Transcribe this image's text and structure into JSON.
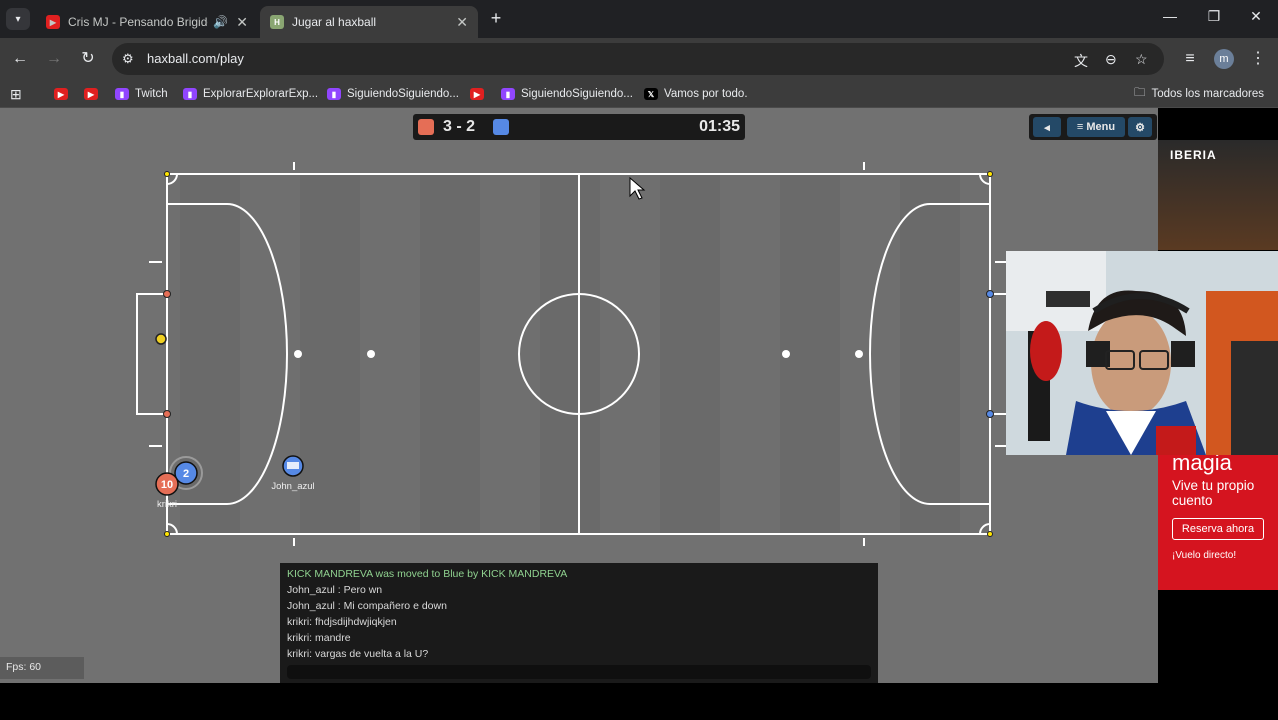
{
  "browser": {
    "tabs": [
      {
        "title": "Cris MJ - Pensando Brigido",
        "active": false,
        "audio": true
      },
      {
        "title": "Jugar al haxball",
        "active": true,
        "audio": false
      }
    ],
    "url": "haxball.com/play",
    "avatar_letter": "m",
    "bookmarks": [
      {
        "label": "",
        "icon": "youtube-icon"
      },
      {
        "label": "",
        "icon": "youtube-icon"
      },
      {
        "label": "Twitch",
        "icon": "twitch-icon"
      },
      {
        "label": "ExplorarExplorarExp...",
        "icon": "twitch-icon"
      },
      {
        "label": "SiguiendoSiguiendo...",
        "icon": "twitch-icon"
      },
      {
        "label": "",
        "icon": "youtube-icon"
      },
      {
        "label": "SiguiendoSiguiendo...",
        "icon": "twitch-icon"
      },
      {
        "label": "Vamos por todo.",
        "icon": "x-icon"
      }
    ],
    "all_bookmarks": "Todos los marcadores"
  },
  "game": {
    "score": "3 - 2",
    "clock": "01:35",
    "red_color": "#e56e56",
    "blue_color": "#5689e5",
    "menu_label": "≡ Menu",
    "players": [
      {
        "name": "krikri",
        "number": "10",
        "team": "red"
      },
      {
        "name": "",
        "number": "2",
        "team": "blue"
      },
      {
        "name": "John_azul",
        "number": "",
        "team": "blue"
      }
    ],
    "chat": [
      {
        "text": "KICK MANDREVA was moved to Blue by KICK MANDREVA",
        "notice": true
      },
      {
        "text": "John_azul : Pero wn",
        "notice": false
      },
      {
        "text": "John_azul : Mi compañero e down",
        "notice": false
      },
      {
        "text": "krikri: fhdjsdijhdwjiqkjen",
        "notice": false
      },
      {
        "text": "krikri: mandre",
        "notice": false
      },
      {
        "text": "krikri: vargas de vuelta a la U?",
        "notice": false
      }
    ],
    "fps": "Fps: 60"
  },
  "ad": {
    "top_brand": "IBERIA",
    "headline": "magia",
    "sub": "Vive tu propio cuento",
    "cta": "Reserva ahora",
    "small": "¡Vuelo directo!"
  }
}
